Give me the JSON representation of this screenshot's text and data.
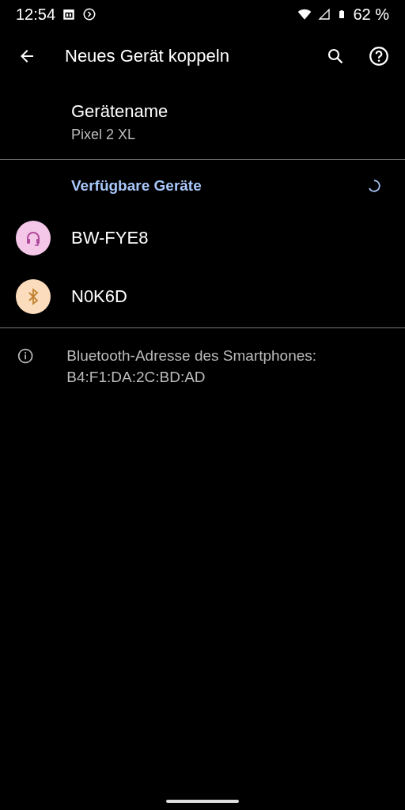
{
  "status_bar": {
    "time": "12:54",
    "battery": "62 %"
  },
  "toolbar": {
    "title": "Neues Gerät koppeln"
  },
  "device_name": {
    "title": "Gerätename",
    "value": "Pixel 2 XL"
  },
  "available": {
    "heading": "Verfügbare Geräte",
    "searching": true,
    "devices": [
      {
        "name": "BW-FYE8",
        "kind": "headset",
        "color": "#f4c6e8"
      },
      {
        "name": "N0K6D",
        "kind": "bluetooth",
        "color": "#fbdcbc"
      }
    ]
  },
  "info": {
    "text": "Bluetooth-Adresse des Smartphones: B4:F1:DA:2C:BD:AD"
  }
}
